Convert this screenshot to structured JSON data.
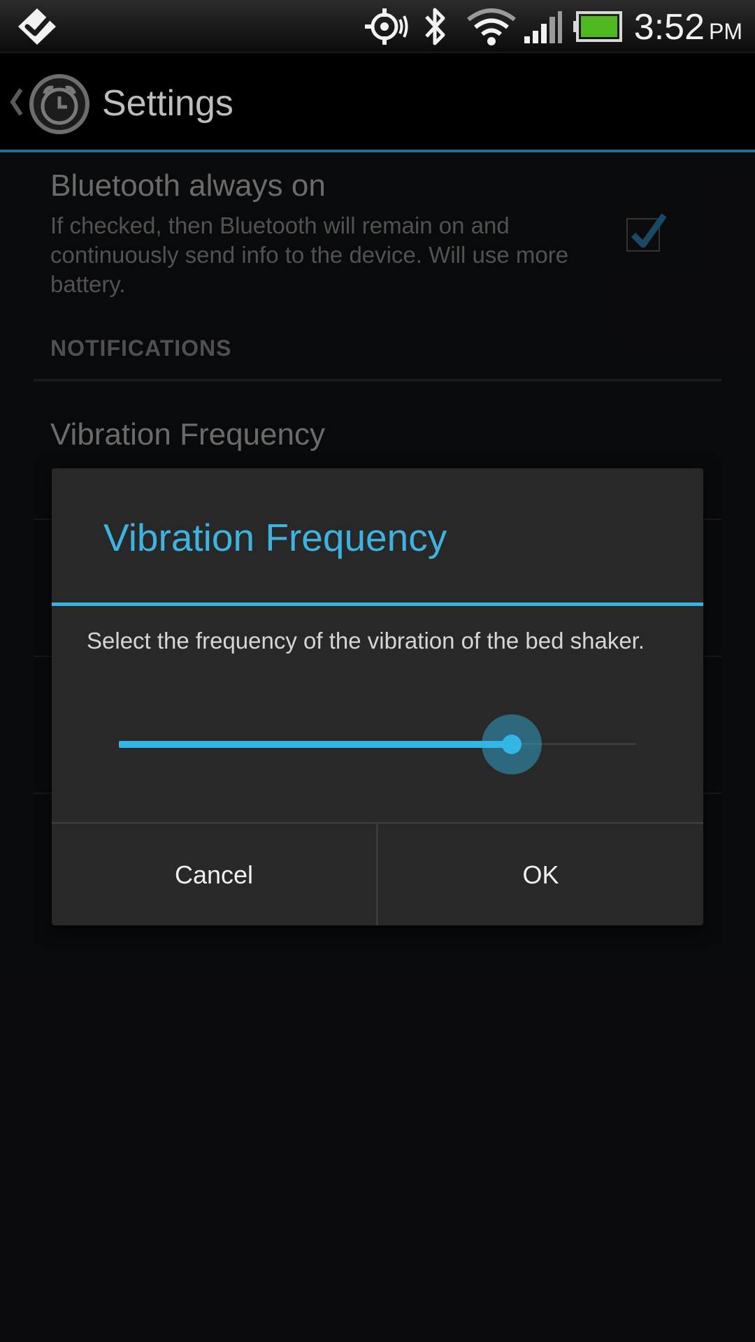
{
  "status_bar": {
    "time": "3:52",
    "ampm": "PM",
    "icons": [
      "foursquare-check-icon",
      "location-target-icon",
      "bluetooth-icon",
      "wifi-icon",
      "cell-signal-icon",
      "battery-icon"
    ]
  },
  "action_bar": {
    "title": "Settings",
    "app_icon": "alarm-clock-icon"
  },
  "settings": {
    "bluetooth": {
      "title": "Bluetooth always on",
      "summary": "If checked, then Bluetooth will remain on and continuously send info to the device. Will use more battery.",
      "checked": true
    },
    "category": "NOTIFICATIONS",
    "vibration": {
      "title": "Vibration Frequency"
    }
  },
  "dialog": {
    "title": "Vibration Frequency",
    "message": "Select the frequency of the vibration of the bed shaker.",
    "slider_value": 0.76,
    "cancel_label": "Cancel",
    "ok_label": "OK"
  },
  "colors": {
    "accent": "#33b5e5",
    "background": "#111215",
    "dialog_bg": "#282828"
  }
}
